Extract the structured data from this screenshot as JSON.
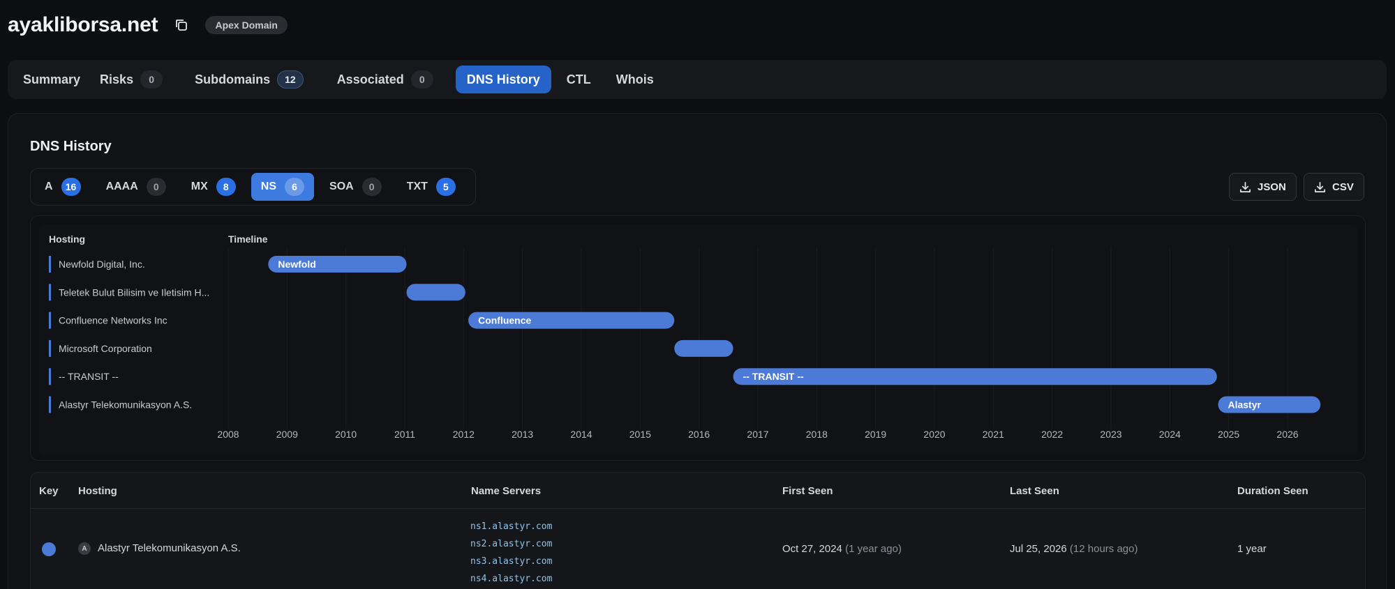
{
  "header": {
    "domain": "ayakliborsa.net",
    "badge": "Apex Domain"
  },
  "tabs": [
    {
      "label": "Summary"
    },
    {
      "label": "Risks",
      "count": "0"
    },
    {
      "label": "Subdomains",
      "count": "12"
    },
    {
      "label": "Associated",
      "count": "0"
    },
    {
      "label": "DNS History",
      "active": true
    },
    {
      "label": "CTL"
    },
    {
      "label": "Whois"
    }
  ],
  "dns_history": {
    "title": "DNS History",
    "record_tabs": [
      {
        "label": "A",
        "count": "16"
      },
      {
        "label": "AAAA",
        "count": "0"
      },
      {
        "label": "MX",
        "count": "8"
      },
      {
        "label": "NS",
        "count": "6",
        "active": true
      },
      {
        "label": "SOA",
        "count": "0"
      },
      {
        "label": "TXT",
        "count": "5"
      }
    ],
    "buttons": {
      "json": "JSON",
      "csv": "CSV"
    }
  },
  "timeline": {
    "hosting_header": "Hosting",
    "timeline_header": "Timeline",
    "bar_color": "#4b7bd6",
    "years": [
      "2008",
      "2009",
      "2010",
      "2011",
      "2012",
      "2013",
      "2014",
      "2015",
      "2016",
      "2017",
      "2018",
      "2019",
      "2020",
      "2021",
      "2022",
      "2023",
      "2024",
      "2025",
      "2026"
    ],
    "rows": [
      {
        "hosting": "Newfold Digital, Inc.",
        "bar_label": "Newfold",
        "start": 2008.68,
        "end": 2011.03
      },
      {
        "hosting": "Teletek Bulut Bilisim ve Iletisim H...",
        "bar_label": "",
        "start": 2011.03,
        "end": 2012.03
      },
      {
        "hosting": "Confluence Networks Inc",
        "bar_label": "Confluence",
        "start": 2012.08,
        "end": 2015.58
      },
      {
        "hosting": "Microsoft Corporation",
        "bar_label": "",
        "start": 2015.58,
        "end": 2016.58
      },
      {
        "hosting": "-- TRANSIT --",
        "bar_label": "-- TRANSIT --",
        "start": 2016.58,
        "end": 2024.8
      },
      {
        "hosting": "Alastyr Telekomunikasyon A.S.",
        "bar_label": "Alastyr",
        "start": 2024.82,
        "end": 2026.56
      }
    ]
  },
  "table": {
    "headers": {
      "key": "Key",
      "hosting": "Hosting",
      "ns": "Name Servers",
      "first": "First Seen",
      "last": "Last Seen",
      "duration": "Duration Seen"
    },
    "rows": [
      {
        "key_color": "#4b7bd6",
        "avatar": "A",
        "hosting": "Alastyr Telekomunikasyon A.S.",
        "name_servers": [
          "ns1.alastyr.com",
          "ns2.alastyr.com",
          "ns3.alastyr.com",
          "ns4.alastyr.com"
        ],
        "first_seen": "Oct 27, 2024",
        "first_seen_rel": "(1 year ago)",
        "last_seen": "Jul 25, 2026",
        "last_seen_rel": "(12 hours ago)",
        "duration": "1 year"
      }
    ]
  }
}
